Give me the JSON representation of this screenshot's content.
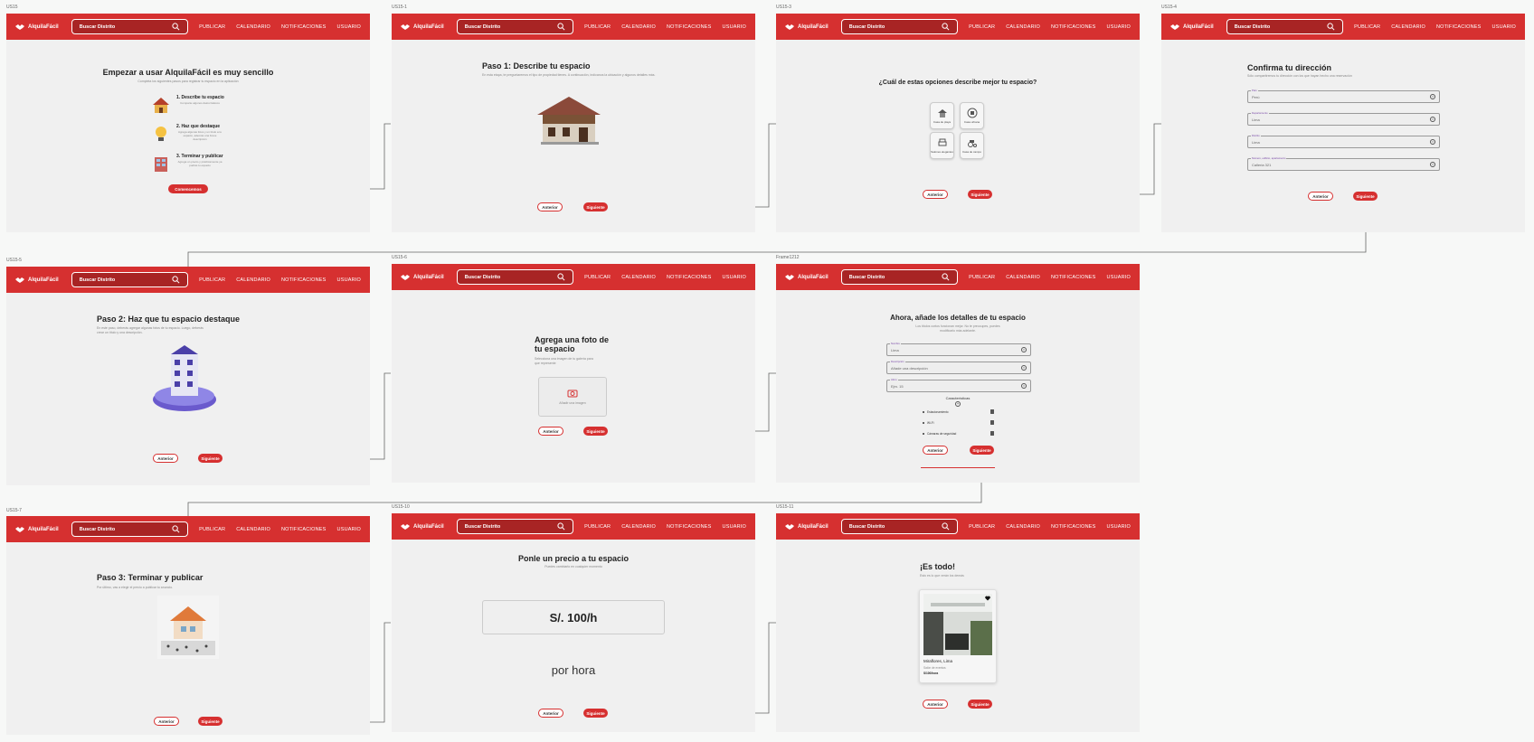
{
  "nav": {
    "brand": "AlquilaFácil",
    "search_placeholder": "Buscar Distrito",
    "links": [
      "PUBLICAR",
      "CALENDARIO",
      "NOTIFICACIONES",
      "USUARIO"
    ]
  },
  "frame_labels": [
    "US15",
    "US15-1",
    "US15-3",
    "US15-4",
    "US15-5",
    "US15-6",
    "Frame1212",
    "US15-7",
    "US15-10",
    "US15-11"
  ],
  "common": {
    "prev": "Anterior",
    "next": "Siguiente"
  },
  "intro": {
    "title": "Empezar a usar AlquilaFácil es muy sencillo",
    "subtitle": "Completa los siguientes pasos para registrar tu espacio en la aplicación",
    "steps": [
      {
        "title": "1. Describe tu espacio",
        "desc": "Comparte algunos datos básicos"
      },
      {
        "title": "2. Haz que destaque",
        "desc": "Agrega algunas fotos y un título a tu espacio, además una breve descripción"
      },
      {
        "title": "3. Terminar y publicar",
        "desc": "Agrega un precio y prácticamente ya podrás tu espacio"
      }
    ],
    "cta": "Comencemos"
  },
  "step1": {
    "title": "Paso 1: Describe tu espacio",
    "desc": "En esta etapa, te preguntaremos el tipo de propiedad tienes. A continuación, indícanos la ubicación y algunos detalles más."
  },
  "types": {
    "title": "¿Cuál de estas opciones describe mejor tu espacio?",
    "options": [
      "Casa de playa",
      "Casa urbana",
      "Salones elegantes",
      "Casa de campo"
    ]
  },
  "address": {
    "title": "Confirma tu dirección",
    "subtitle": "Sólo compartiremos tu dirección con los que hayan hecho una reservación",
    "fields": [
      {
        "label": "País",
        "value": "Perú"
      },
      {
        "label": "Departamento",
        "value": "Lima"
      },
      {
        "label": "Distrito",
        "value": "Lima"
      },
      {
        "label": "Número, edificio, apartamento",
        "value": "Calleria 321"
      }
    ]
  },
  "step2": {
    "title": "Paso 2: Haz que tu espacio destaque",
    "desc": "En este paso, deberás agregar algunas fotos de tu espacio. Luego, deberás crear un título y una descripción."
  },
  "photo": {
    "title": "Agrega una foto de tu espacio",
    "subtitle": "Selecciona una imagen de tu galería para que represente",
    "upload": "Añadir una imagen"
  },
  "details": {
    "title": "Ahora, añade los detalles de tu espacio",
    "subtitle": "Los títulos cortos funcionan mejor. No te preocupes, puedes modificarlo más adelante.",
    "fields": [
      {
        "label": "Nombre",
        "value": "Lima"
      },
      {
        "label": "Descripción",
        "value": "Añade una descripción"
      },
      {
        "label": "Aforo",
        "value": "Ejm. 15"
      }
    ],
    "features_title": "Características",
    "features": [
      "Estacionamiento",
      "Wi-Fi",
      "Cámaras de seguridad"
    ]
  },
  "step3": {
    "title": "Paso 3: Terminar y publicar",
    "desc": "Por último, vas a elegir el precio a publicar tu anuncio."
  },
  "price": {
    "title": "Ponle un precio a tu espacio",
    "subtitle": "Puedes cambiarlo en cualquier momento",
    "amount": "S/. 100/h",
    "unit": "por hora"
  },
  "done": {
    "title": "¡Es todo!",
    "subtitle": "Esto es lo que verán los demás",
    "card_location": "Miraflores, Lima",
    "card_type": "Salón de eventos",
    "card_price": "S/100/hora"
  }
}
